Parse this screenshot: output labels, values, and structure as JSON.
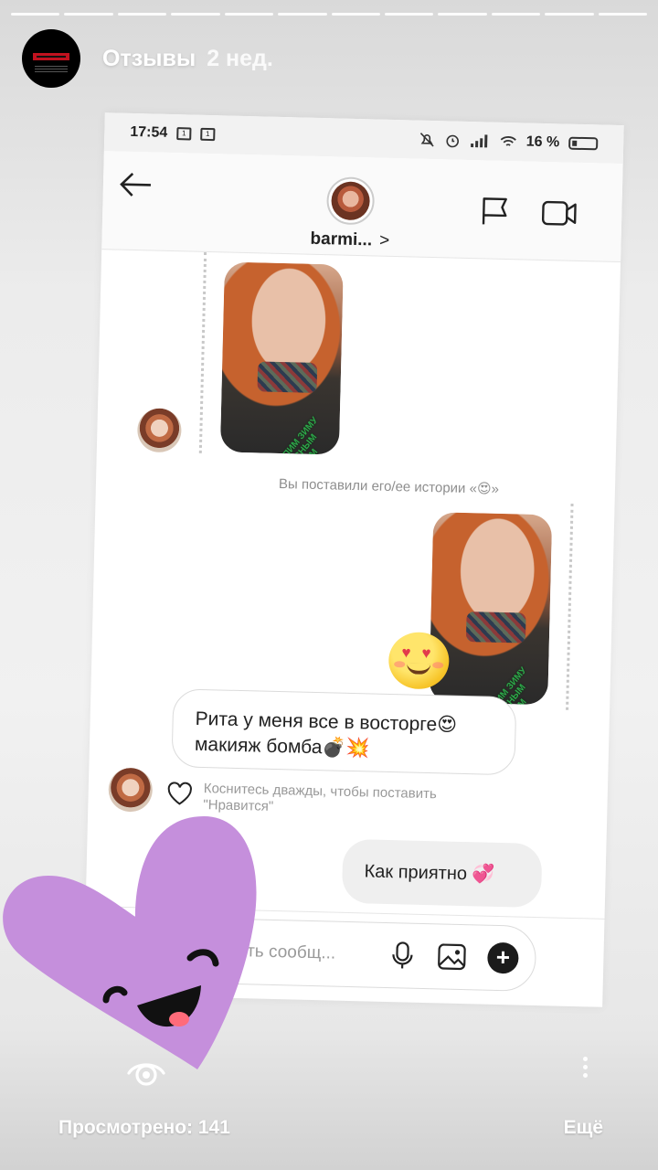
{
  "story": {
    "progress_segments": 12,
    "title": "Отзывы",
    "time": "2 нед.",
    "viewed": "Просмотрено: 141",
    "more": "Ещё"
  },
  "statusbar": {
    "time": "17:54",
    "notif_badges": [
      "1",
      "1"
    ],
    "battery": "16 %"
  },
  "dm": {
    "name": "barmi...",
    "chevron": ">",
    "reply_note": "Вы поставили его/ее истории «😍»",
    "photo_overlay": "РАСТОПИМ ЗИМУ\nПРЕКРАСНЫМ\nМАКИЯЖЕМ",
    "incoming_message": "Рита у меня все в восторге😍 макияж бомба💣💥",
    "like_hint": "Коснитесь дважды, чтобы поставить \"Нравится\"",
    "outgoing_message": "Как приятно 💞",
    "composer_placeholder": "ить сообщ..."
  },
  "icons": [
    "back-arrow-icon",
    "flag-icon",
    "video-call-icon",
    "microphone-icon",
    "gallery-icon",
    "plus-icon",
    "heart-icon",
    "eye-icon",
    "more-dots-icon"
  ],
  "colors": {
    "sticker": "#c58fdc",
    "photo_text": "#2ea84a"
  }
}
